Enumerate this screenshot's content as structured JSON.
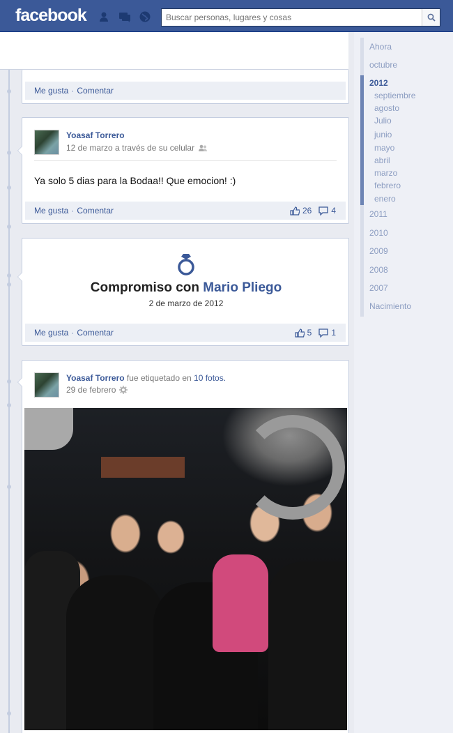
{
  "header": {
    "logo": "facebook",
    "search_placeholder": "Buscar personas, lugares y cosas",
    "jewels": [
      "friend-requests-icon",
      "messages-icon",
      "notifications-globe-icon"
    ],
    "search_icon": "magnifier-icon",
    "colors": {
      "bar": "#3b5998",
      "link": "#3b5998"
    }
  },
  "posts": [
    {
      "footer": {
        "like": "Me gusta",
        "sep": "·",
        "comment": "Comentar"
      }
    },
    {
      "author": "Yoasaf Torrero",
      "meta": "12 de marzo a través de su celular",
      "audience_icon": "friends-icon",
      "text": "Ya solo 5 dias para la Bodaa!! Que emocion! :)",
      "footer": {
        "like": "Me gusta",
        "sep": "·",
        "comment": "Comentar",
        "likes": "26",
        "comments": "4"
      }
    },
    {
      "type": "milestone",
      "icon": "ring-icon",
      "title_prefix": "Compromiso con",
      "title_link": "Mario Pliego",
      "date": "2 de marzo de 2012",
      "footer": {
        "like": "Me gusta",
        "sep": "·",
        "comment": "Comentar",
        "likes": "5",
        "comments": "1"
      }
    },
    {
      "author": "Yoasaf Torrero",
      "action": "fue etiquetado en",
      "action_link": "10 fotos.",
      "meta": "29 de febrero",
      "audience_icon": "public-gear-icon",
      "photo_icon": "group-photo"
    }
  ],
  "sidebar": {
    "items_top": [
      "Ahora",
      "octubre"
    ],
    "active_year": "2012",
    "months": [
      "septiembre",
      "agosto",
      "Julio",
      "junio",
      "mayo",
      "abril",
      "marzo",
      "febrero",
      "enero"
    ],
    "years": [
      "2011",
      "2010",
      "2009",
      "2008",
      "2007",
      "Nacimiento"
    ]
  }
}
